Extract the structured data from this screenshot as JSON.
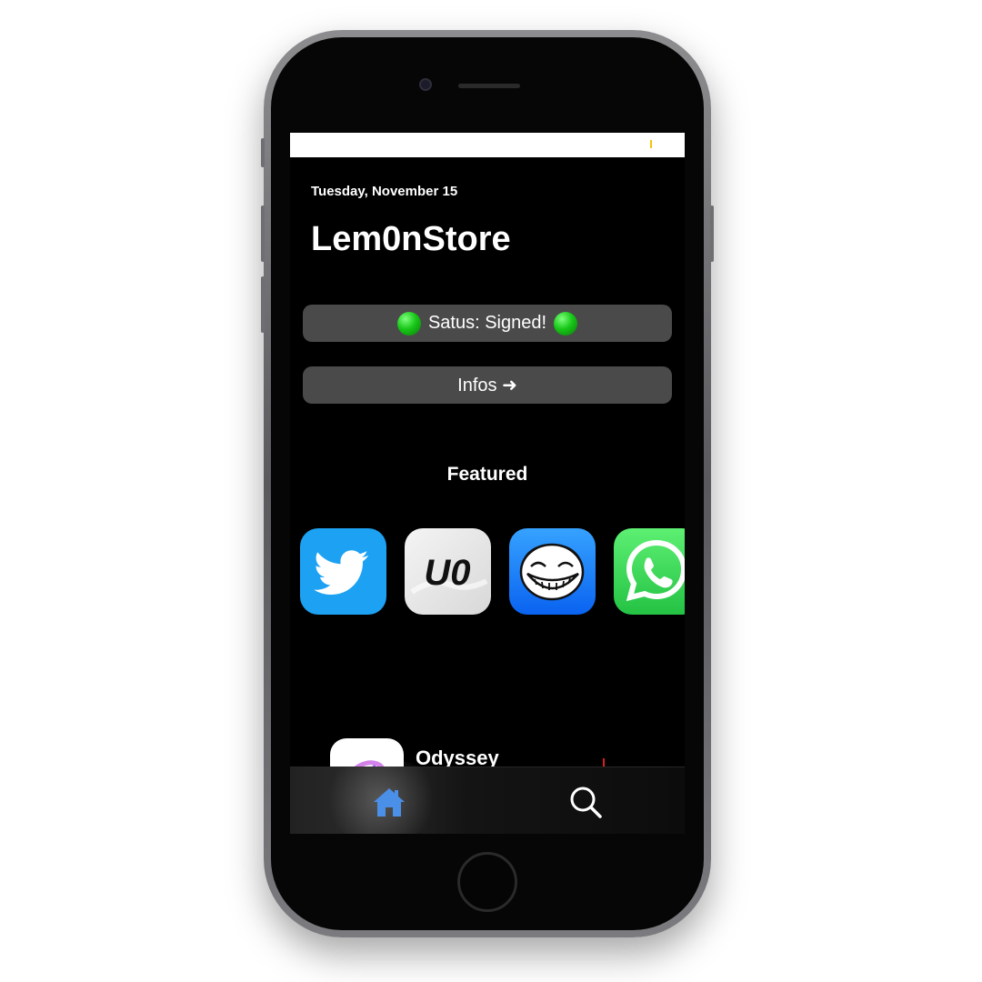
{
  "status_bar": {
    "indicator_color": "#f4c20d"
  },
  "header": {
    "date": "Tuesday, November 15",
    "title": "Lem0nStore"
  },
  "status_button": {
    "label": "Satus: Signed!",
    "indicator_color": "#18c818"
  },
  "infos_button": {
    "label": "Infos ➜"
  },
  "featured": {
    "heading": "Featured",
    "apps": [
      {
        "icon": "twitter-icon"
      },
      {
        "icon": "unc0ver-icon",
        "logo_text": "U0"
      },
      {
        "icon": "trollface-icon"
      },
      {
        "icon": "whatsapp-icon"
      }
    ]
  },
  "list": {
    "items": [
      {
        "name": "Odyssey",
        "icon": "odyssey-icon"
      }
    ]
  },
  "tab_bar": {
    "tabs": [
      {
        "name": "home",
        "icon": "home-icon",
        "active": true,
        "color": "#4a8fe8"
      },
      {
        "name": "search",
        "icon": "search-icon",
        "active": false,
        "color": "#ffffff"
      }
    ]
  }
}
